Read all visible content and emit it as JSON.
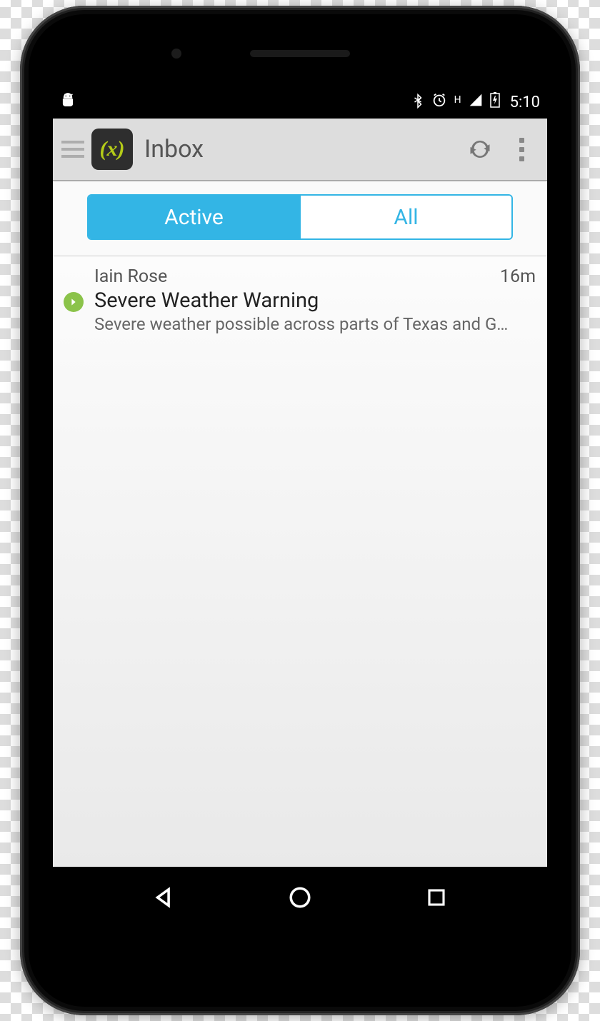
{
  "status_bar": {
    "time": "5:10",
    "signal_label": "H"
  },
  "action_bar": {
    "title": "Inbox",
    "app_icon_text": "(x)"
  },
  "tabs": {
    "active_label": "Active",
    "all_label": "All"
  },
  "messages": [
    {
      "sender": "Iain Rose",
      "time": "16m",
      "subject": "Severe Weather Warning",
      "preview": "Severe weather possible across parts of Texas and G…"
    }
  ]
}
